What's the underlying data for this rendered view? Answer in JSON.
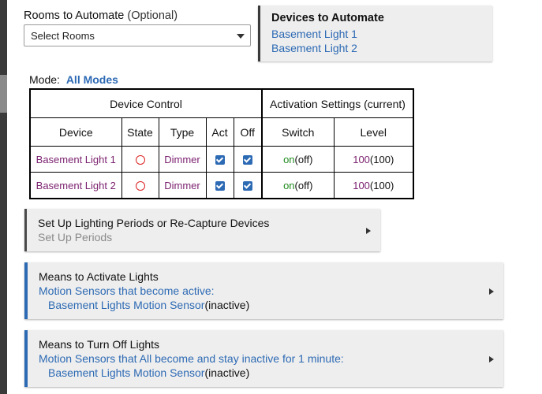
{
  "rooms": {
    "label": "Rooms to Automate",
    "optional": "(Optional)",
    "value": "Select Rooms"
  },
  "devices": {
    "title": "Devices to Automate",
    "items": [
      "Basement Light 1",
      "Basement Light 2"
    ]
  },
  "mode": {
    "label": "Mode:",
    "value": "All Modes"
  },
  "table": {
    "group_device_control": "Device Control",
    "group_activation": "Activation Settings (current)",
    "headers": [
      "Device",
      "State",
      "Type",
      "Act",
      "Off",
      "Switch",
      "Level"
    ],
    "rows": [
      {
        "device": "Basement Light 1",
        "type": "Dimmer",
        "act": true,
        "off": true,
        "switch_on": "on",
        "switch_cur": "(off)",
        "level": "100",
        "level_cur": "(100)"
      },
      {
        "device": "Basement Light 2",
        "type": "Dimmer",
        "act": true,
        "off": true,
        "switch_on": "on",
        "switch_cur": "(off)",
        "level": "100",
        "level_cur": "(100)"
      }
    ]
  },
  "panels": {
    "periods": {
      "title": "Set Up Lighting Periods or Re-Capture Devices",
      "subtitle": "Set Up Periods"
    },
    "activate": {
      "title": "Means to Activate Lights",
      "subtitle": "Motion Sensors that become active:",
      "device": "Basement Lights Motion Sensor",
      "state": "(inactive)"
    },
    "turnoff": {
      "title": "Means to Turn Off Lights",
      "subtitle": "Motion Sensors that All become and stay inactive for 1 minute:",
      "device": "Basement Lights Motion Sensor",
      "state": "(inactive)"
    }
  },
  "colors": {
    "accent": "#2d6ab4",
    "device_text": "#7a1f6e",
    "on_text": "#1e8a1e",
    "state_off": "#dd2222"
  }
}
